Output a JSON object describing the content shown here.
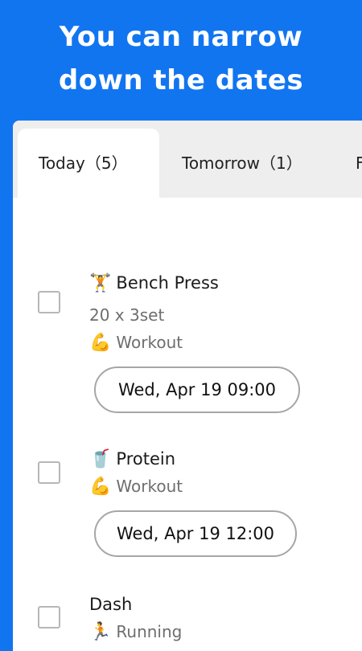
{
  "hero": {
    "line1": "You can narrow",
    "line2": "down the dates"
  },
  "tabs": [
    {
      "label": "Today（5）"
    },
    {
      "label": "Tomorrow（1）"
    },
    {
      "label": "F"
    }
  ],
  "tasks": [
    {
      "emoji": "🏋️",
      "title": "Bench Press",
      "detail": "20 x 3set",
      "category_emoji": "💪",
      "category": "Workout",
      "date": "Wed, Apr 19 09:00"
    },
    {
      "emoji": "🥤",
      "title": "Protein",
      "category_emoji": "💪",
      "category": "Workout",
      "date": "Wed, Apr 19 12:00"
    },
    {
      "title": "Dash",
      "category_emoji": "🏃",
      "category": "Running"
    }
  ]
}
